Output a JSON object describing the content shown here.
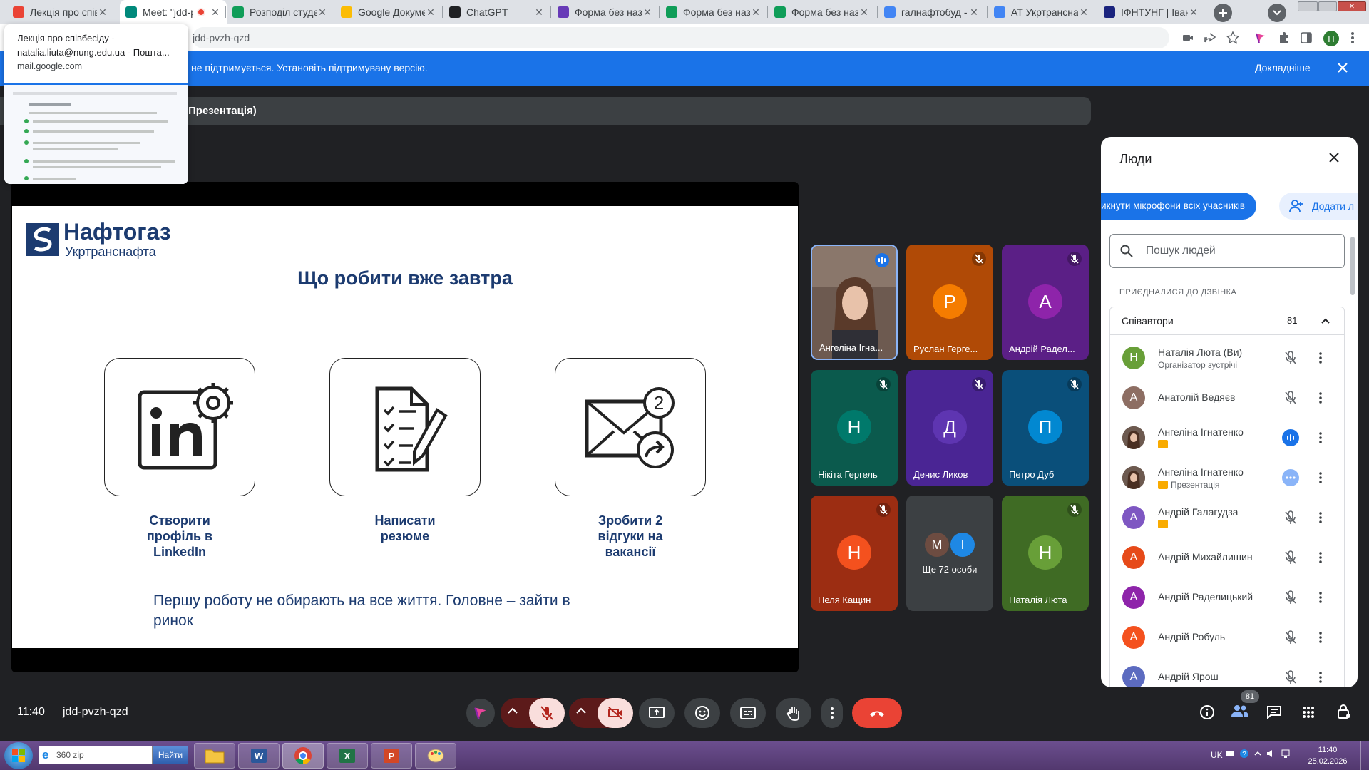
{
  "tabs": [
    {
      "label": "Лекція про співбесіду",
      "icon": "gmail-icon",
      "color": "#ea4335"
    },
    {
      "label": "Meet: \"jdd-pvzh-qzd\"",
      "icon": "meet-icon",
      "color": "#00897b"
    },
    {
      "label": "Розподіл студентів",
      "icon": "sheets-icon",
      "color": "#0f9d58"
    },
    {
      "label": "Google Документи",
      "icon": "drive-icon",
      "color": "#fbbc04"
    },
    {
      "label": "ChatGPT",
      "icon": "chatgpt-icon",
      "color": "#202124"
    },
    {
      "label": "Форма без назви",
      "icon": "forms-icon",
      "color": "#673ab7"
    },
    {
      "label": "Форма без назви",
      "icon": "sheets-icon",
      "color": "#0f9d58"
    },
    {
      "label": "Форма без назви",
      "icon": "sheets-icon",
      "color": "#0f9d58"
    },
    {
      "label": "галнафтобуд - Пошук",
      "icon": "google-icon",
      "color": "#4285f4"
    },
    {
      "label": "АТ Укртранснафта",
      "icon": "google-icon",
      "color": "#4285f4"
    },
    {
      "label": "ІФНТУНГ | Івано-Франківськ",
      "icon": "university-icon",
      "color": "#1a237e"
    }
  ],
  "tooltip": {
    "title": "Лекція про співбесіду - natalia.liuta@nung.edu.ua - Пошта...",
    "domain": "mail.google.com"
  },
  "address": {
    "url": "jdd-pvzh-qzd"
  },
  "profile_initial": "Н",
  "banner": {
    "message": "не підтримується. Установіть підтримувану версію.",
    "learn_more": "Докладніше"
  },
  "presentation_label": "Презентація)",
  "slide": {
    "logo_name": "Нафтогаз",
    "logo_sub": "Укртранснафта",
    "title": "Що робити вже завтра",
    "cards": [
      {
        "line1": "Створити",
        "line2": "профіль в",
        "line3": "LinkedIn"
      },
      {
        "line1": "Написати",
        "line2": "резюме",
        "line3": ""
      },
      {
        "line1": "Зробити 2",
        "line2": "відгуки на",
        "line3": "вакансії"
      }
    ],
    "footer_line1": "Першу роботу не обирають на все життя. Головне – зайти в",
    "footer_line2": "ринок",
    "badge_number": "2"
  },
  "tiles": [
    {
      "name": "Ангеліна Ігна...",
      "initial": "",
      "bg": "#5f4b3f",
      "avatar": "",
      "mic": "speaking"
    },
    {
      "name": "Руслан Герге...",
      "initial": "Р",
      "bg": "#b04a06",
      "avatar": "#f57c00",
      "mic": "muted"
    },
    {
      "name": "Андрій Радел...",
      "initial": "А",
      "bg": "#5b1f86",
      "avatar": "#8e24aa",
      "mic": "muted"
    },
    {
      "name": "Нікіта Гергель",
      "initial": "Н",
      "bg": "#0b5a4d",
      "avatar": "#00796b",
      "mic": "muted"
    },
    {
      "name": "Денис Ликов",
      "initial": "Д",
      "bg": "#4a2594",
      "avatar": "#5e35b1",
      "mic": "muted"
    },
    {
      "name": "Петро Дуб",
      "initial": "П",
      "bg": "#0a4f7a",
      "avatar": "#0288d1",
      "mic": "muted"
    },
    {
      "name": "Неля Кащин",
      "initial": "Н",
      "bg": "#9c2d12",
      "avatar": "#f4511e",
      "mic": "muted"
    },
    {
      "name": "Ще 72 особи",
      "initial": "",
      "bg": "#3c4043",
      "avatar": "",
      "mic": "none"
    },
    {
      "name": "Наталія Люта",
      "initial": "Н",
      "bg": "#3f6b24",
      "avatar": "#689f38",
      "mic": "muted"
    }
  ],
  "more_tile": {
    "a": "М",
    "b": "І"
  },
  "people": {
    "title": "Люди",
    "mute_all": "икнути мікрофони всіх учасників",
    "add_people": "Додати л",
    "search_placeholder": "Пошук людей",
    "section_label": "ПРИЄДНАЛИСЯ ДО ДЗВІНКА",
    "group_label": "Співавтори",
    "group_count": "81",
    "rows": [
      {
        "name": "Наталія Люта (Ви)",
        "sub": "Організатор зустрічі",
        "initial": "Н",
        "color": "#689f38",
        "state": "muted"
      },
      {
        "name": "Анатолій Ведяєв",
        "sub": "",
        "initial": "А",
        "color": "#8d6e63",
        "state": "muted"
      },
      {
        "name": "Ангеліна Ігнатенко",
        "sub": "",
        "initial": "",
        "color": "#5f4b3f",
        "state": "speaking"
      },
      {
        "name": "Ангеліна Ігнатенко",
        "sub": "Презентація",
        "initial": "",
        "color": "#5f4b3f",
        "state": "more"
      },
      {
        "name": "Андрій Галагудза",
        "sub": "",
        "initial": "А",
        "color": "#7e57c2",
        "state": "muted"
      },
      {
        "name": "Андрій Михайлишин",
        "sub": "",
        "initial": "А",
        "color": "#e64a19",
        "state": "muted"
      },
      {
        "name": "Андрій Раделицький",
        "sub": "",
        "initial": "А",
        "color": "#8e24aa",
        "state": "muted"
      },
      {
        "name": "Андрій Робуль",
        "sub": "",
        "initial": "А",
        "color": "#f4511e",
        "state": "muted"
      },
      {
        "name": "Андрій Ярош",
        "sub": "",
        "initial": "А",
        "color": "#5c6bc0",
        "state": "muted"
      }
    ]
  },
  "meeting": {
    "time": "11:40",
    "code": "jdd-pvzh-qzd"
  },
  "participants_badge": "81",
  "taskbar": {
    "search_value": "360 zip",
    "search_button": "Найти",
    "language": "UK",
    "clock_time": "11:40",
    "clock_date": "25.02.2026"
  }
}
